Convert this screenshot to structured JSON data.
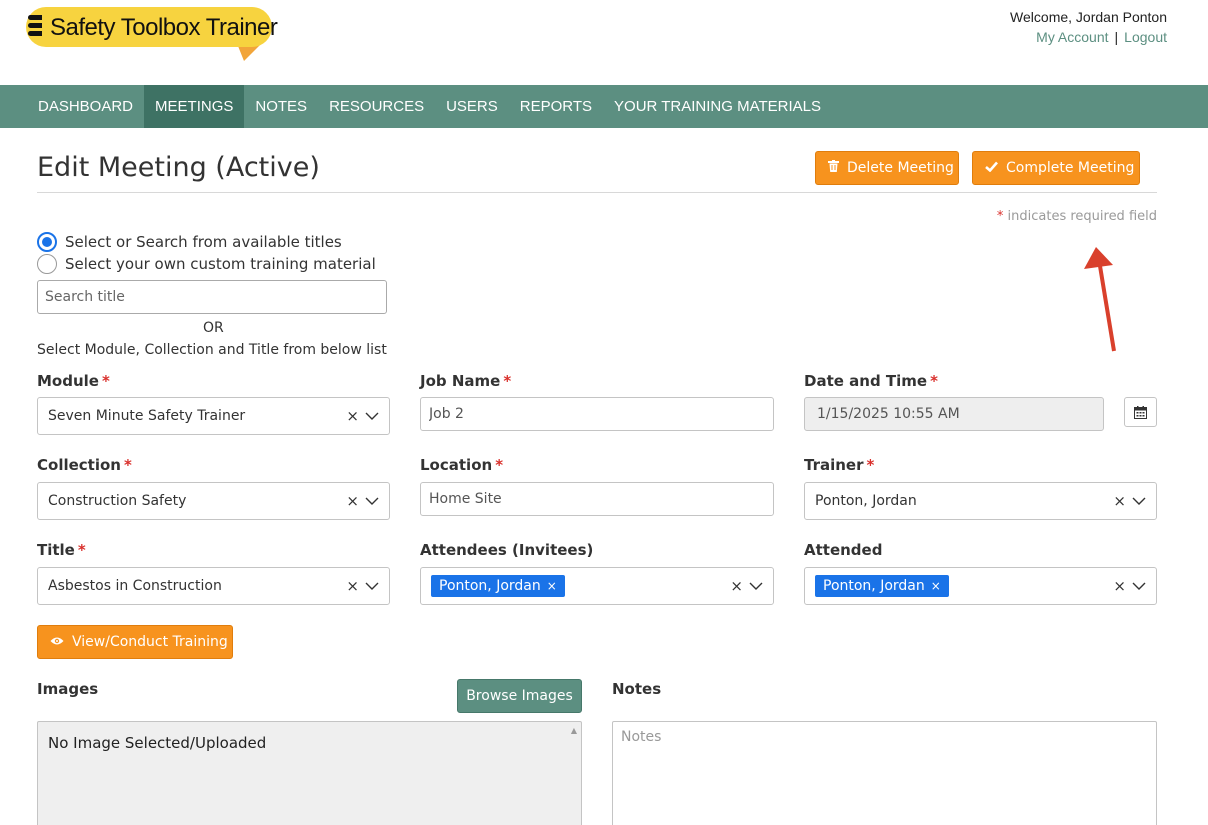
{
  "header": {
    "logo_text": "Safety Toolbox Trainer",
    "welcome": "Welcome, Jordan Ponton",
    "my_account": "My Account",
    "separator": "|",
    "logout": "Logout"
  },
  "nav": {
    "items": [
      "DASHBOARD",
      "MEETINGS",
      "NOTES",
      "RESOURCES",
      "USERS",
      "REPORTS",
      "YOUR TRAINING MATERIALS"
    ],
    "active": "MEETINGS"
  },
  "page": {
    "title": "Edit Meeting (Active)",
    "delete_label": "Delete Meeting",
    "complete_label": "Complete Meeting",
    "required_star": "*",
    "required_note": "indicates required field"
  },
  "source_options": {
    "option1": "Select or Search from available titles",
    "option2": "Select your own custom training material",
    "selected": "option1",
    "search_placeholder": "Search title",
    "or_text": "OR",
    "hint": "Select Module, Collection and Title from below list"
  },
  "form": {
    "module": {
      "label": "Module",
      "value": "Seven Minute Safety Trainer"
    },
    "collection": {
      "label": "Collection",
      "value": "Construction Safety"
    },
    "title": {
      "label": "Title",
      "value": "Asbestos in Construction"
    },
    "job_name": {
      "label": "Job Name",
      "value": "Job 2"
    },
    "location": {
      "label": "Location",
      "value": "Home Site"
    },
    "attendees": {
      "label": "Attendees (Invitees)",
      "tags": [
        "Ponton, Jordan"
      ]
    },
    "date_time": {
      "label": "Date and Time",
      "value": "1/15/2025 10:55 AM"
    },
    "trainer": {
      "label": "Trainer",
      "value": "Ponton, Jordan"
    },
    "attended": {
      "label": "Attended",
      "tags": [
        "Ponton, Jordan"
      ]
    },
    "required_star": "*",
    "clear_glyph": "×"
  },
  "training": {
    "view_label": "View/Conduct Training"
  },
  "images": {
    "label": "Images",
    "browse_label": "Browse Images",
    "empty_text": "No Image Selected/Uploaded"
  },
  "notes": {
    "label": "Notes",
    "placeholder": "Notes"
  },
  "colors": {
    "nav": "#5c8f81",
    "nav_active": "#3e7264",
    "accent_orange": "#f7931e",
    "tag_blue": "#1a73e8",
    "required_red": "#d9302c",
    "annotation_arrow": "#d9402c"
  },
  "icons": {
    "delete": "trash-icon",
    "complete": "check-icon",
    "view": "eye-icon",
    "calendar": "calendar-icon",
    "dropdown": "chevron-down-icon"
  }
}
